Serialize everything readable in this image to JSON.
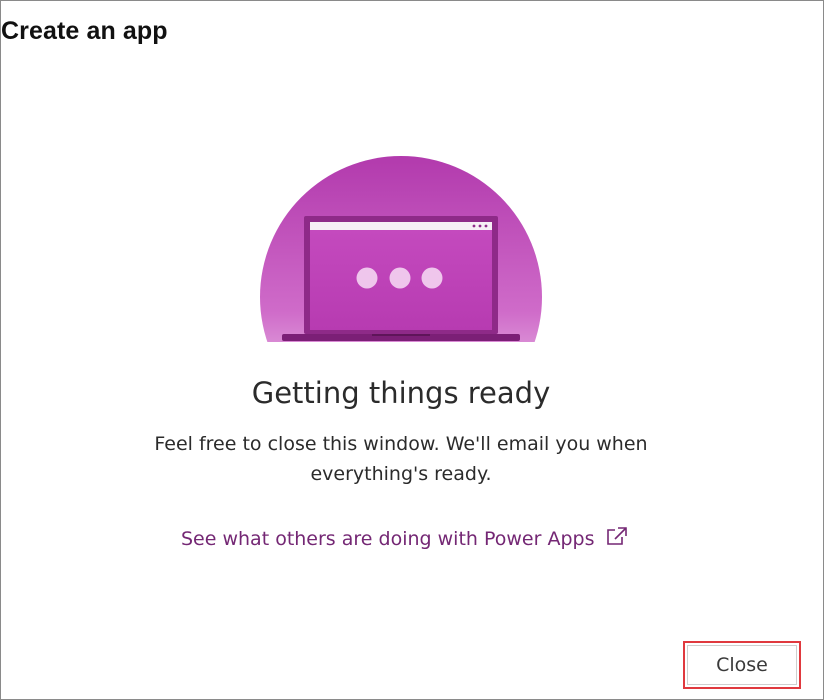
{
  "dialog": {
    "title": "Create an app"
  },
  "illustration": {
    "icon": "laptop-loading-illustration",
    "accent_color": "#b93db4",
    "dark_color": "#7b1f76"
  },
  "status": {
    "heading": "Getting things ready",
    "message": "Feel free to close this window. We'll email you when everything's ready."
  },
  "link": {
    "label": "See what others are doing with Power Apps",
    "icon": "external-link-icon",
    "color": "#742774"
  },
  "footer": {
    "close_label": "Close",
    "highlight_color": "#e0393e"
  }
}
